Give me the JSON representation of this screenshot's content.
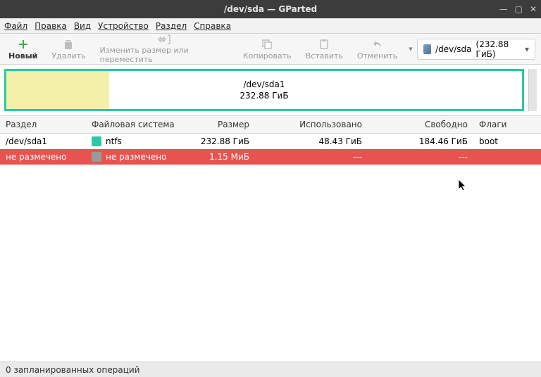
{
  "window": {
    "title": "/dev/sda — GParted"
  },
  "menu": {
    "file": "Файл",
    "edit": "Правка",
    "view": "Вид",
    "device": "Устройство",
    "partition": "Раздел",
    "help": "Справка"
  },
  "toolbar": {
    "new": "Новый",
    "delete": "Удалить",
    "resize": "Изменить размер или переместить",
    "copy": "Копировать",
    "paste": "Вставить",
    "undo": "Отменить"
  },
  "device_selector": {
    "device": "/dev/sda",
    "size": "(232.88 ГиБ)"
  },
  "diskmap": {
    "name": "/dev/sda1",
    "size": "232.88 ГиБ"
  },
  "headers": {
    "partition": "Раздел",
    "filesystem": "Файловая система",
    "size": "Размер",
    "used": "Использовано",
    "free": "Свободно",
    "flags": "Флаги"
  },
  "rows": [
    {
      "partition": "/dev/sda1",
      "fs": "ntfs",
      "fs_color": "#2ac9a3",
      "size": "232.88 ГиБ",
      "used": "48.43 ГиБ",
      "free": "184.46 ГиБ",
      "flags": "boot"
    },
    {
      "partition": "не размечено",
      "fs": "не размечено",
      "fs_color": "#9a9a9a",
      "size": "1.15 МиБ",
      "used": "---",
      "free": "---",
      "flags": ""
    }
  ],
  "status": "0 запланированных операций"
}
